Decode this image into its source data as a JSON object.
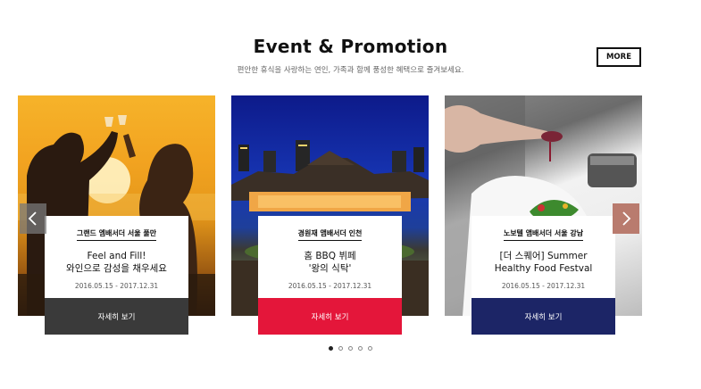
{
  "header": {
    "title": "Event & Promotion",
    "subtitle": "편안한 휴식을 사랑하는 연인, 가족과 함께 풍성한 혜택으로 즐겨보세요.",
    "more_label": "MORE"
  },
  "cards": [
    {
      "location": "그랜드 엠배서더 서울 풀만",
      "title_line1": "Feel and Fill!",
      "title_line2": "와인으로 감성을 채우세요",
      "date": "2016.05.15 - 2017.12.31",
      "cta_label": "자세히 보기",
      "cta_color": "#3a3a3a"
    },
    {
      "location": "경원재 앰배서더 인천",
      "title_line1": "홈 BBQ 뷔페",
      "title_line2": "'왕의 식탁'",
      "date": "2016.05.15 - 2017.12.31",
      "cta_label": "자세히 보기",
      "cta_color": "#e4163a"
    },
    {
      "location": "노보텔 앰배서더 서울 강남",
      "title_line1": "[더 스퀘어] Summer",
      "title_line2": "Healthy Food Festval",
      "date": "2016.05.15 - 2017.12.31",
      "cta_label": "자세히 보기",
      "cta_color": "#1c2566"
    }
  ],
  "carousel": {
    "prev_icon": "chevron-left-icon",
    "next_icon": "chevron-right-icon",
    "page_count": 5,
    "active_page": 1
  }
}
